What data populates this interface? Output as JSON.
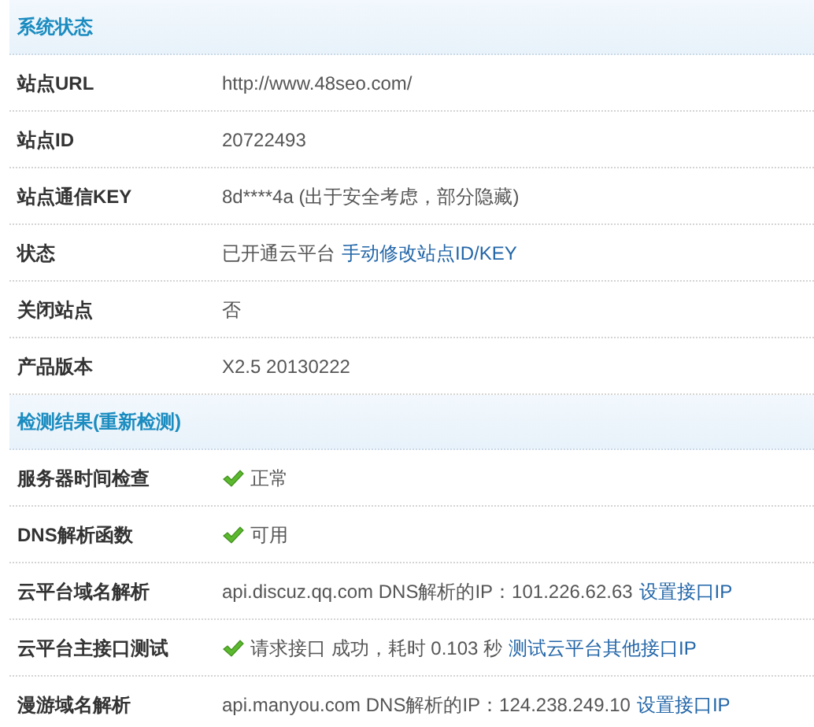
{
  "sections": [
    {
      "title": "系统状态",
      "rows": [
        {
          "label": "站点URL",
          "value": [
            {
              "kind": "text",
              "text": "http://www.48seo.com/"
            }
          ]
        },
        {
          "label": "站点ID",
          "value": [
            {
              "kind": "text",
              "text": "20722493"
            }
          ]
        },
        {
          "label": "站点通信KEY",
          "value": [
            {
              "kind": "text",
              "text": "8d****4a (出于安全考虑，部分隐藏)"
            }
          ]
        },
        {
          "label": "状态",
          "value": [
            {
              "kind": "text",
              "text": "已开通云平台"
            },
            {
              "kind": "link",
              "text": "手动修改站点ID/KEY"
            }
          ]
        },
        {
          "label": "关闭站点",
          "value": [
            {
              "kind": "text",
              "text": "否"
            }
          ]
        },
        {
          "label": "产品版本",
          "value": [
            {
              "kind": "text",
              "text": "X2.5 20130222"
            }
          ]
        }
      ]
    },
    {
      "title": "检测结果(重新检测)",
      "rows": [
        {
          "label": "服务器时间检查",
          "value": [
            {
              "kind": "check"
            },
            {
              "kind": "text",
              "text": "正常"
            }
          ]
        },
        {
          "label": "DNS解析函数",
          "value": [
            {
              "kind": "check"
            },
            {
              "kind": "text",
              "text": "可用"
            }
          ]
        },
        {
          "label": "云平台域名解析",
          "value": [
            {
              "kind": "text",
              "text": "api.discuz.qq.com DNS解析的IP：101.226.62.63"
            },
            {
              "kind": "link",
              "text": "设置接口IP"
            }
          ]
        },
        {
          "label": "云平台主接口测试",
          "value": [
            {
              "kind": "check"
            },
            {
              "kind": "text",
              "text": "请求接口 成功，耗时 0.103 秒"
            },
            {
              "kind": "link",
              "text": "测试云平台其他接口IP"
            }
          ]
        },
        {
          "label": "漫游域名解析",
          "value": [
            {
              "kind": "text",
              "text": "api.manyou.com DNS解析的IP：124.238.249.10"
            },
            {
              "kind": "link",
              "text": "设置接口IP"
            }
          ]
        }
      ]
    }
  ]
}
